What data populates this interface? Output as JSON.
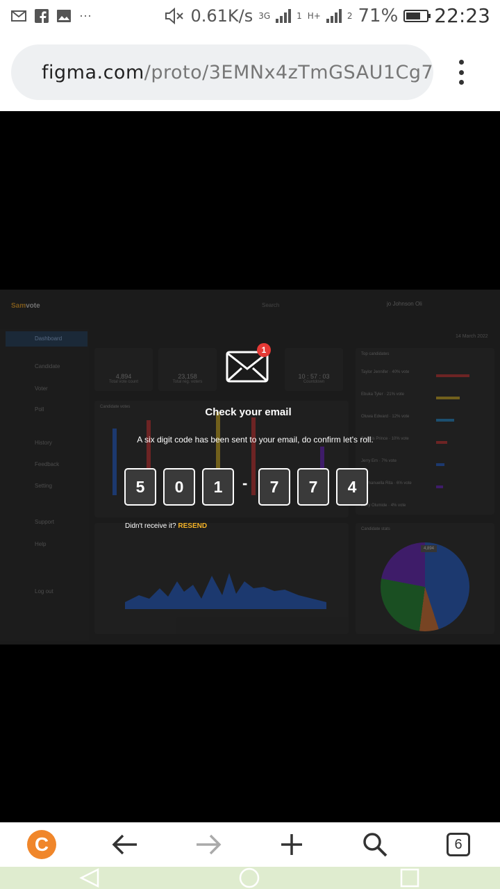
{
  "status_bar": {
    "left_icons": [
      "gmail-icon",
      "facebook-icon",
      "gallery-icon",
      "more-icon"
    ],
    "mute_icon": "speaker-mute-icon",
    "network_speed": "0.61K/s",
    "network_type_1": "3G",
    "sim_1": "1",
    "network_type_2": "H+",
    "sim_2": "2",
    "battery_percent": "71%",
    "battery_level": 0.71,
    "time": "22:23"
  },
  "browser": {
    "url_domain": "figma.com",
    "url_path": "/proto/3EMNx4zTmGSAU1Cg7"
  },
  "dashboard": {
    "logo_first": "Sam",
    "logo_second": "vote",
    "search_placeholder": "Search",
    "user_initials": "jo",
    "user_name": "Johnson Oli",
    "date": "14 March 2022",
    "nav": [
      "Dashboard",
      "Candidate",
      "Voter",
      "Poll",
      "History",
      "Feedback",
      "Setting",
      "Support",
      "Help"
    ],
    "logout": "Log out",
    "stat_cards": [
      {
        "value": "4,894",
        "label": "Total vote count"
      },
      {
        "value": "23,158",
        "label": "Total reg. voters"
      },
      {
        "value": "10 : 57 : 03",
        "label": "Countdown"
      }
    ],
    "candidates": [
      {
        "name": "Taylor Jennifer",
        "pct": "40% vote"
      },
      {
        "name": "Ebuka Tyler",
        "pct": "21% vote"
      },
      {
        "name": "Oluwa Edward",
        "pct": "12% vote"
      },
      {
        "name": "Francis Prince",
        "pct": "10% vote"
      },
      {
        "name": "Jerry Em",
        "pct": "7% vote"
      },
      {
        "name": "Emmanuella Rita",
        "pct": "6% vote"
      },
      {
        "name": "Jerry Olumide",
        "pct": "4% vote"
      }
    ],
    "pie_label": "4,894",
    "panel_titles": {
      "candidates": "Top candidates",
      "stats": "Candidate stats",
      "chart": "Candidate votes"
    }
  },
  "modal": {
    "icon": "envelope-icon",
    "badge": "1",
    "title": "Check your email",
    "subtitle": "A six digit code has been sent to your email, do confirm let's roll.",
    "code_digits": [
      "5",
      "0",
      "1",
      "7",
      "7",
      "4"
    ],
    "separator": "-",
    "resend_prompt": "Didn't receive it?",
    "resend_link": "RESEND"
  },
  "bottom_nav": {
    "home_logo": "C",
    "tabs_count": "6"
  },
  "colors": {
    "resend": "#f5b327",
    "badge": "#e53935",
    "logo": "#f0862a"
  }
}
